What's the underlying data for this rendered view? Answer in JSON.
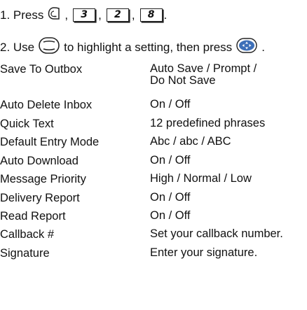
{
  "steps": {
    "step1": {
      "prefix": "1. Press",
      "keys": [
        "3",
        "2",
        "8"
      ],
      "sep": ",",
      "end": "."
    },
    "step2": {
      "prefix": "2. Use",
      "middle": "to highlight a setting, then press",
      "end": "."
    }
  },
  "icons": {
    "menu_key": "menu-key-icon",
    "nav_key": "navigation-key-icon",
    "ok_key": "ok-key-icon"
  },
  "settings": [
    {
      "label": "Save To Outbox",
      "value": "Auto Save / Prompt /\nDo Not Save"
    },
    {
      "label": "Auto Delete Inbox",
      "value": "On / Off"
    },
    {
      "label": "Quick Text",
      "value": "12 predefined phrases"
    },
    {
      "label": "Default Entry Mode",
      "value": "Abc / abc / ABC"
    },
    {
      "label": "Auto Download",
      "value": "On / Off"
    },
    {
      "label": "Message Priority",
      "value": "High / Normal / Low"
    },
    {
      "label": "Delivery Report",
      "value": "On / Off"
    },
    {
      "label": "Read Report",
      "value": "On / Off"
    },
    {
      "label": "Callback #",
      "value": "Set your callback number."
    },
    {
      "label": "Signature",
      "value": "Enter your signature."
    }
  ]
}
